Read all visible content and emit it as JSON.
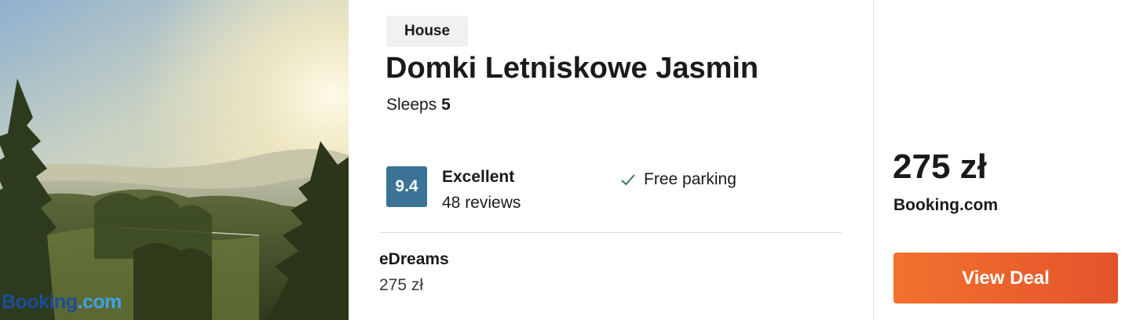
{
  "listing": {
    "type_badge": "House",
    "title": "Domki Letniskowe Jasmin",
    "sleeps_label": "Sleeps",
    "sleeps_count": "5",
    "photo_watermark_a": "Booking",
    "photo_watermark_b": ".com"
  },
  "rating": {
    "score": "9.4",
    "label": "Excellent",
    "reviews": "48 reviews"
  },
  "amenities": [
    {
      "label": "Free parking",
      "icon": "check-icon"
    }
  ],
  "other_offer": {
    "provider": "eDreams",
    "price": "275 zł"
  },
  "best_offer": {
    "price": "275 zł",
    "provider": "Booking.com",
    "button_label": "View Deal"
  },
  "colors": {
    "score_bg": "#3a7396",
    "button_start": "#f2722e",
    "button_end": "#e4532b",
    "check": "#2e7d5b"
  }
}
